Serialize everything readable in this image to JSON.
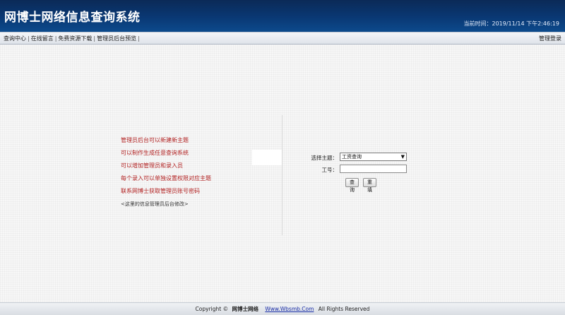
{
  "header": {
    "title": "网博士网络信息查询系统",
    "time_label": "当前时间：",
    "time_value": "2019/11/14 下午2:46:19"
  },
  "nav": {
    "links": [
      "查询中心",
      "在线留言",
      "免费资源下载",
      "管理员后台预览"
    ],
    "separator": "|",
    "right_link": "管理登录"
  },
  "notes": {
    "items": [
      "管理员后台可以新建新主题",
      "可以制作生成任意查询系统",
      "可以增加管理员和录入员",
      "每个录入可以单独设置权限对应主题",
      "联系网博士获取管理员账号密码"
    ],
    "small": "<这里的信息管理员后台修改>"
  },
  "form": {
    "topic_label": "选择主题：",
    "topic_selected": "工资查询",
    "id_label": "工号：",
    "id_value": "",
    "query_button": "查询",
    "reset_button": "重填"
  },
  "footer": {
    "copyright": "Copyright ©",
    "brand": "网博士网络",
    "site": "Www.Wbsmb.Com",
    "rights": "All Rights Reserved"
  }
}
